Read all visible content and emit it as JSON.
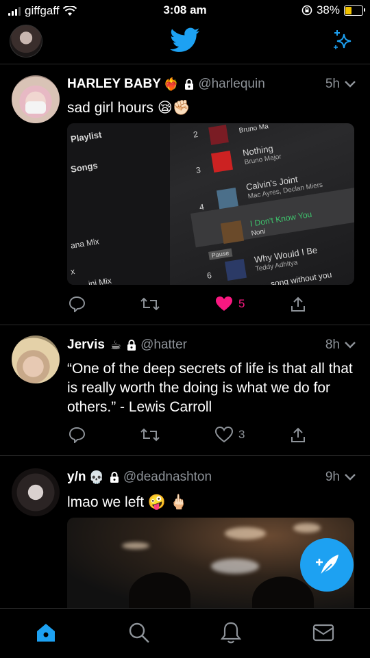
{
  "status": {
    "carrier": "giffgaff",
    "time": "3:08 am",
    "battery": "38%"
  },
  "nav": {
    "avatar": "profile avatar",
    "logo": "twitter-bird-icon",
    "sparkle": "sparkle-icon"
  },
  "colors": {
    "accent": "#1da1f2",
    "like": "#f91880",
    "battery": "#f2c200",
    "muted": "#8e9399"
  },
  "tweets": [
    {
      "name": "HARLEY BABY",
      "name_emoji": "❤️‍🔥",
      "handle": "@harlequin",
      "time": "5h",
      "text": "sad girl hours 😪✊🏻",
      "likes": "5",
      "liked": true,
      "media_rows": [
        "Playlist",
        "Songs",
        "ana Mix",
        "x",
        "ini Mix",
        "Bruno Ma",
        "Nothing",
        "Bruno Major",
        "Calvin's Joint",
        "Mac Ayres, Declan Miers",
        "I Don't Know You",
        "Noni",
        "Why Would I Be",
        "Teddy Adhitya",
        "Pause",
        "song without you",
        "2",
        "3",
        "4",
        "6"
      ]
    },
    {
      "name": "Jervis",
      "name_emoji": "☕",
      "handle": "@hatter",
      "time": "8h",
      "text": "“One of the deep secrets of life is that all that is really worth the doing is what we do for others.” - Lewis Carroll",
      "likes": "3",
      "liked": false
    },
    {
      "name": "y/n",
      "name_emoji": "💀",
      "handle": "@deadnashton",
      "time": "9h",
      "text": "lmao we left 🤪 🖕🏻"
    }
  ],
  "tabs": [
    "home-icon",
    "search-icon",
    "notifications-icon",
    "messages-icon"
  ]
}
